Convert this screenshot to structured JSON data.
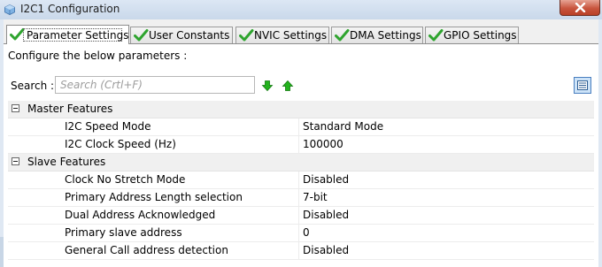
{
  "window": {
    "title": "I2C1 Configuration",
    "icon": "cube-icon",
    "close_icon": "close-icon"
  },
  "tabs": [
    {
      "label": "Parameter Settings",
      "active": true,
      "icon": "check-icon"
    },
    {
      "label": "User Constants",
      "active": false,
      "icon": "check-icon"
    },
    {
      "label": "NVIC Settings",
      "active": false,
      "icon": "check-icon"
    },
    {
      "label": "DMA Settings",
      "active": false,
      "icon": "check-icon"
    },
    {
      "label": "GPIO Settings",
      "active": false,
      "icon": "check-icon"
    }
  ],
  "panel": {
    "configure_label": "Configure the below parameters :",
    "search_label": "Search :",
    "search_placeholder": "Search (Crtl+F)",
    "search_down_icon": "arrow-down-icon",
    "search_up_icon": "arrow-up-icon",
    "view_icon": "list-view-icon"
  },
  "groups": [
    {
      "label": "Master Features",
      "params": [
        {
          "name": "I2C Speed Mode",
          "value": "Standard Mode"
        },
        {
          "name": "I2C Clock Speed (Hz)",
          "value": "100000"
        }
      ]
    },
    {
      "label": "Slave Features",
      "params": [
        {
          "name": "Clock No Stretch Mode",
          "value": "Disabled"
        },
        {
          "name": "Primary Address Length selection",
          "value": "7-bit"
        },
        {
          "name": "Dual Address Acknowledged",
          "value": "Disabled"
        },
        {
          "name": "Primary slave address",
          "value": "0"
        },
        {
          "name": "General Call address detection",
          "value": "Disabled"
        }
      ]
    }
  ],
  "colors": {
    "check_green": "#2ea42e",
    "arrow_green": "#22b21d",
    "close_red": "#c8553e",
    "selection_blue": "#4a7fbf"
  }
}
